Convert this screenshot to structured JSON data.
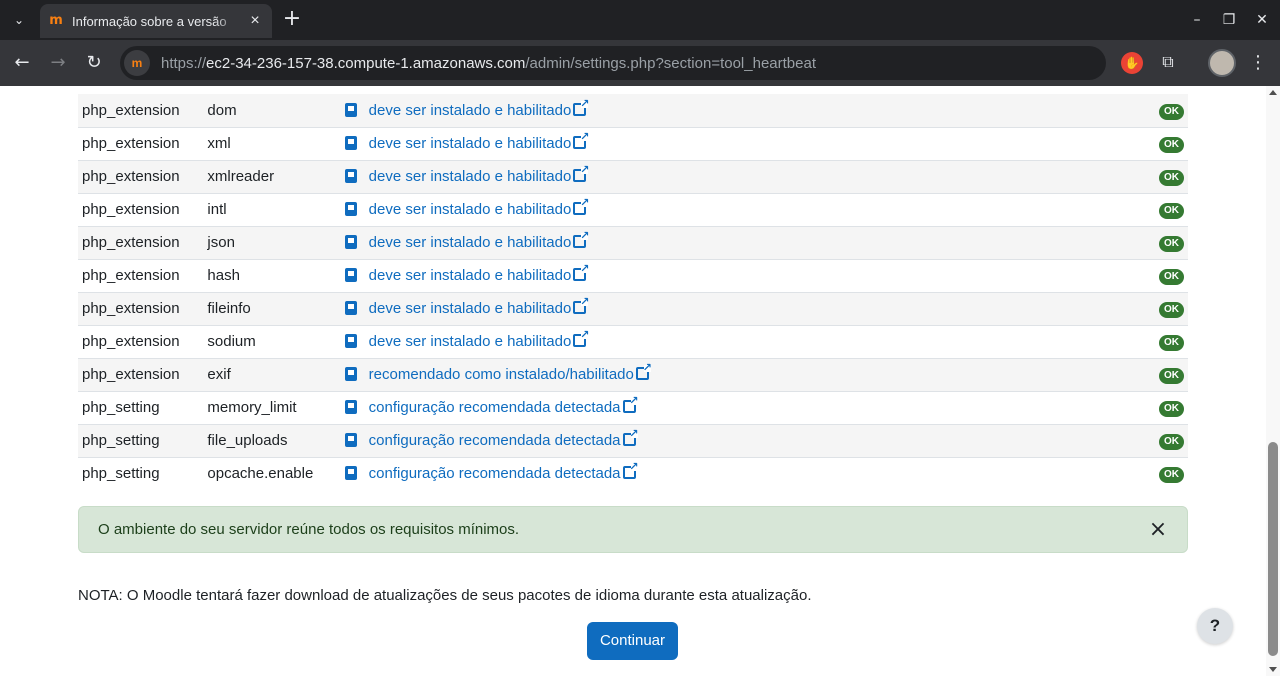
{
  "browser": {
    "tab_title": "Informação sobre a versão",
    "url_prefix": "https://",
    "url_host": "ec2-34-236-157-38.compute-1.amazonaws.com",
    "url_path": "/admin/settings.php?section=tool_heartbeat",
    "favicon": "m"
  },
  "env_rows": [
    {
      "type": "php_extension",
      "name": "dom",
      "report": "deve ser instalado e habilitado",
      "status": "OK"
    },
    {
      "type": "php_extension",
      "name": "xml",
      "report": "deve ser instalado e habilitado",
      "status": "OK"
    },
    {
      "type": "php_extension",
      "name": "xmlreader",
      "report": "deve ser instalado e habilitado",
      "status": "OK"
    },
    {
      "type": "php_extension",
      "name": "intl",
      "report": "deve ser instalado e habilitado",
      "status": "OK"
    },
    {
      "type": "php_extension",
      "name": "json",
      "report": "deve ser instalado e habilitado",
      "status": "OK"
    },
    {
      "type": "php_extension",
      "name": "hash",
      "report": "deve ser instalado e habilitado",
      "status": "OK"
    },
    {
      "type": "php_extension",
      "name": "fileinfo",
      "report": "deve ser instalado e habilitado",
      "status": "OK"
    },
    {
      "type": "php_extension",
      "name": "sodium",
      "report": "deve ser instalado e habilitado",
      "status": "OK"
    },
    {
      "type": "php_extension",
      "name": "exif",
      "report": "recomendado como instalado/habilitado",
      "status": "OK"
    },
    {
      "type": "php_setting",
      "name": "memory_limit",
      "report": "configuração recomendada detectada",
      "status": "OK"
    },
    {
      "type": "php_setting",
      "name": "file_uploads",
      "report": "configuração recomendada detectada",
      "status": "OK"
    },
    {
      "type": "php_setting",
      "name": "opcache.enable",
      "report": "configuração recomendada detectada",
      "status": "OK"
    }
  ],
  "alert": {
    "text": "O ambiente do seu servidor reúne todos os requisitos mínimos.",
    "close": "×"
  },
  "note": "NOTA: O Moodle tentará fazer download de atualizações de seus pacotes de idioma durante esta atualização.",
  "continue_label": "Continuar",
  "help_label": "?",
  "colors": {
    "primary": "#0f6cbf",
    "success_badge": "#357a32",
    "alert_bg": "#d7e6d7"
  }
}
